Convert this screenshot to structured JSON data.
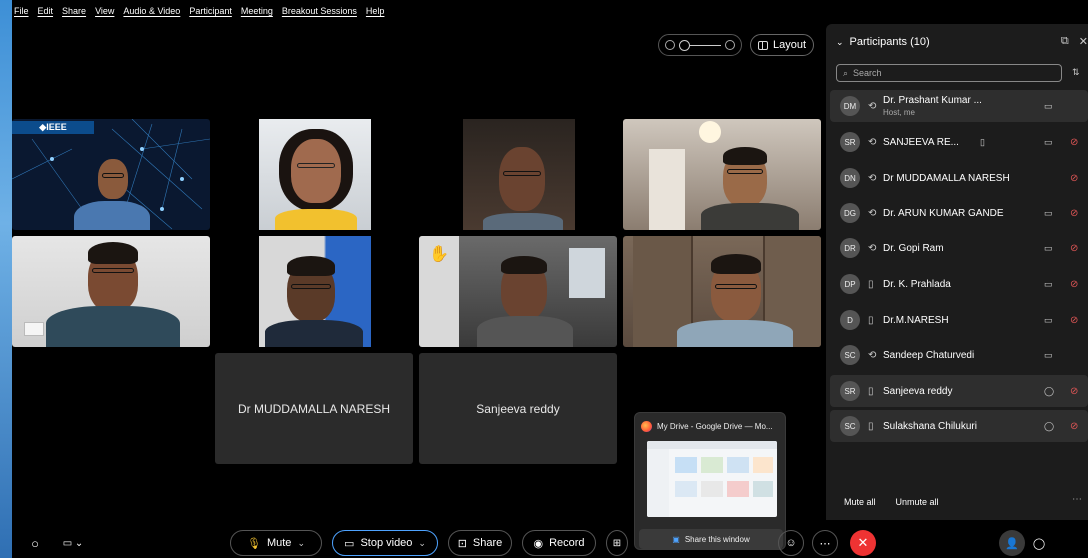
{
  "menu": [
    "File",
    "Edit",
    "Share",
    "View",
    "Audio & Video",
    "Participant",
    "Meeting",
    "Breakout Sessions",
    "Help"
  ],
  "topbar": {
    "layout_label": "Layout"
  },
  "tiles": {
    "ieee_logo": "◆IEEE",
    "name_tiles": [
      "Dr MUDDAMALLA NARESH",
      "Sanjeeva reddy"
    ]
  },
  "preview": {
    "title": "My Drive - Google Drive — Mo...",
    "share_label": "Share this window"
  },
  "toolbar": {
    "mute_label": "Mute",
    "stop_video_label": "Stop video",
    "share_label": "Share",
    "record_label": "Record"
  },
  "participants": {
    "title": "Participants (10)",
    "search_placeholder": "Search",
    "items": [
      {
        "initials": "DM",
        "name": "Dr. Prashant Kumar ...",
        "sub": "Host, me"
      },
      {
        "initials": "SR",
        "name": "SANJEEVA RE..."
      },
      {
        "initials": "DN",
        "name": "Dr MUDDAMALLA NARESH"
      },
      {
        "initials": "DG",
        "name": "Dr. ARUN KUMAR GANDE"
      },
      {
        "initials": "DR",
        "name": "Dr. Gopi Ram"
      },
      {
        "initials": "DP",
        "name": "Dr. K. Prahlada"
      },
      {
        "initials": "D",
        "name": "Dr.M.NARESH"
      },
      {
        "initials": "SC",
        "name": "Sandeep Chaturvedi"
      },
      {
        "initials": "SR",
        "name": "Sanjeeva reddy"
      },
      {
        "initials": "SC",
        "name": "Sulakshana Chilukuri"
      }
    ],
    "mute_all": "Mute all",
    "unmute_all": "Unmute all"
  },
  "colors": {
    "end_call": "#e33333",
    "accent": "#4ea3ff",
    "muted": "#e05656"
  }
}
